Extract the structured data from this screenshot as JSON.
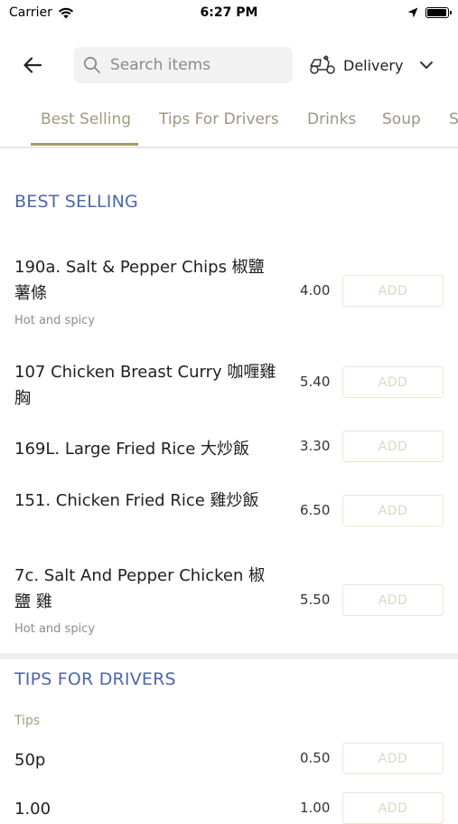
{
  "status_bar": {
    "carrier": "Carrier",
    "time": "6:27 PM"
  },
  "header": {
    "search_placeholder": "Search items",
    "delivery_label": "Delivery"
  },
  "tabs": [
    {
      "label": "Best Selling",
      "active": true
    },
    {
      "label": "Tips For Drivers",
      "active": false
    },
    {
      "label": "Drinks",
      "active": false
    },
    {
      "label": "Soup",
      "active": false
    },
    {
      "label": "S",
      "active": false
    }
  ],
  "sections": {
    "best_selling": {
      "title": "BEST SELLING",
      "items": [
        {
          "name": "190a. Salt & Pepper Chips 椒鹽薯條",
          "description": "Hot and spicy",
          "price": "4.00",
          "button": "ADD"
        },
        {
          "name": "107 Chicken Breast Curry 咖喱雞胸",
          "description": "",
          "price": "5.40",
          "button": "ADD"
        },
        {
          "name": "169L. Large Fried Rice 大炒飯",
          "description": "",
          "price": "3.30",
          "button": "ADD"
        },
        {
          "name": "151. Chicken Fried Rice 雞炒飯",
          "description": "",
          "price": "6.50",
          "button": "ADD"
        },
        {
          "name": "7c. Salt And Pepper Chicken 椒 鹽 雞",
          "description": "Hot and spicy",
          "price": "5.50",
          "button": "ADD"
        }
      ]
    },
    "tips_for_drivers": {
      "title": "TIPS FOR DRIVERS",
      "subsection": "Tips",
      "items": [
        {
          "name": "50p",
          "price": "0.50",
          "button": "ADD"
        },
        {
          "name": "1.00",
          "price": "1.00",
          "button": "ADD"
        }
      ]
    }
  }
}
